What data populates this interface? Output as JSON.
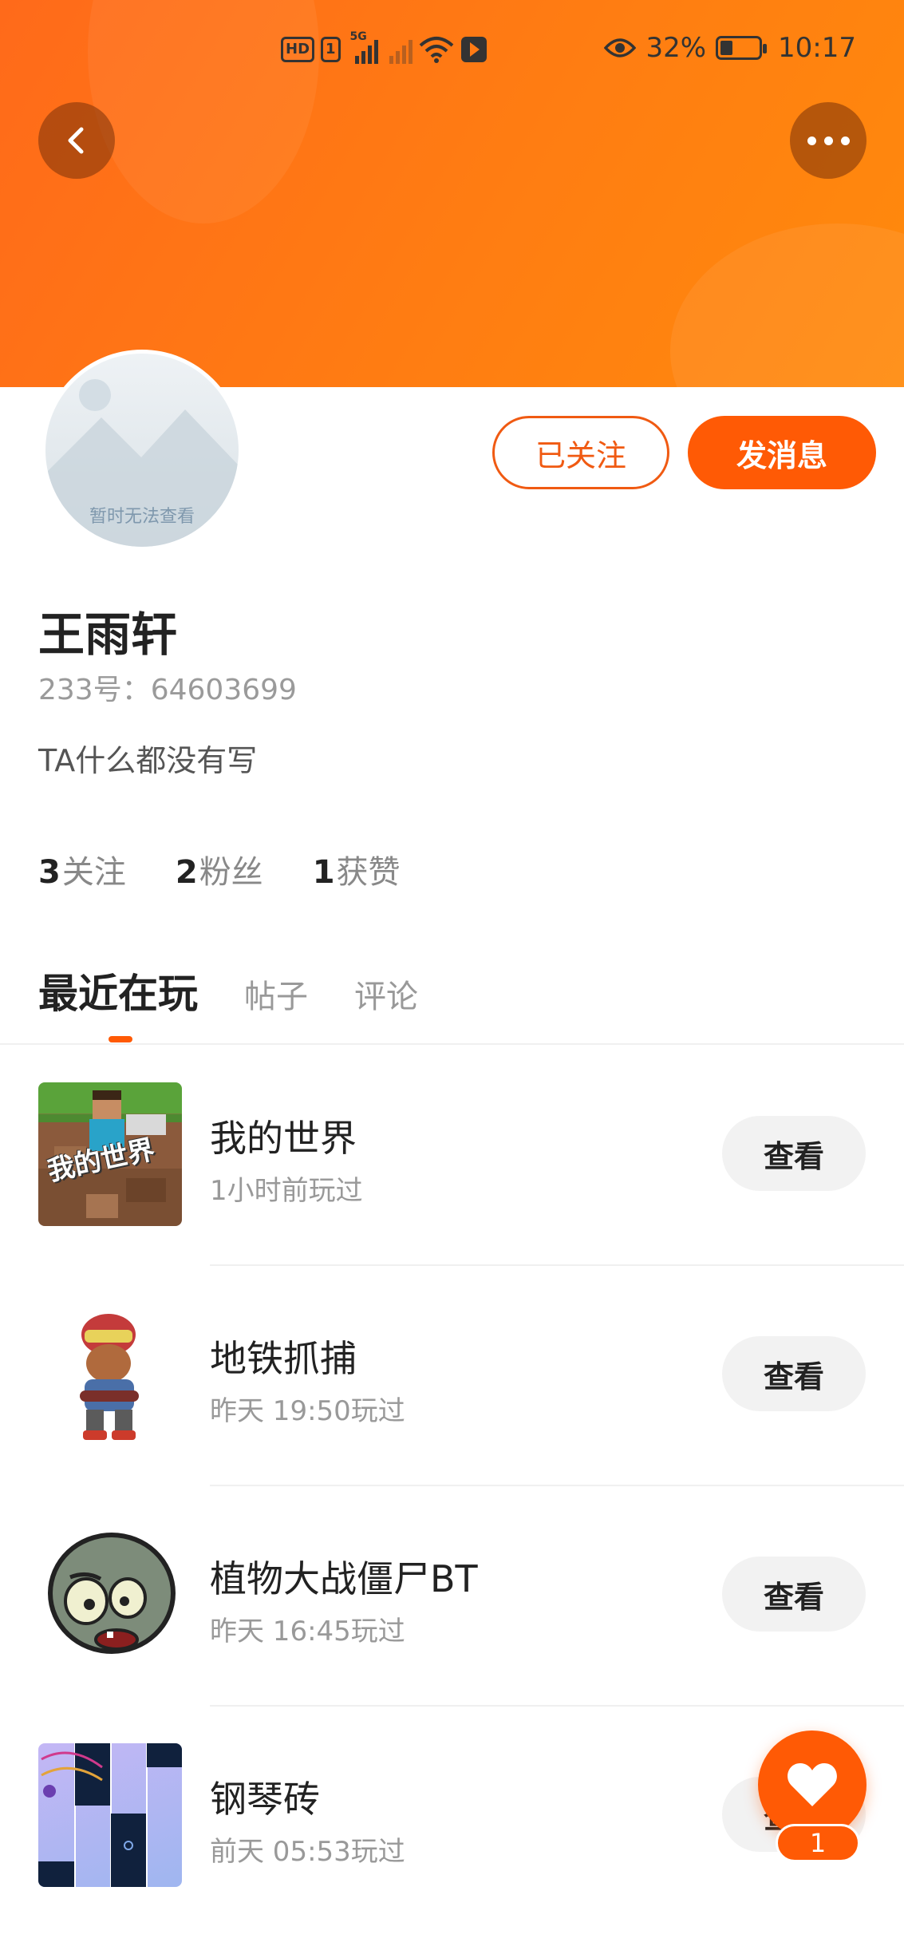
{
  "status_bar": {
    "hd_badge": "HD",
    "sim_badge": "1",
    "network_tag": "5G",
    "battery_pct": "32%",
    "battery_level": 0.32,
    "time": "10:17",
    "icons": [
      "signal-icon",
      "wifi-icon",
      "app-notification-icon",
      "eye-icon",
      "battery-icon"
    ]
  },
  "header": {
    "accent_color": "#ff6a1a",
    "back_icon": "chevron-left-icon",
    "more_icon": "more-dots-icon"
  },
  "profile": {
    "avatar_label": "暂时无法查看",
    "name": "王雨轩",
    "uid": "233号：64603699",
    "bio": "TA什么都没有写",
    "follow_label": "已关注",
    "message_label": "发消息",
    "stats": [
      {
        "count": "3",
        "label": "关注"
      },
      {
        "count": "2",
        "label": "粉丝"
      },
      {
        "count": "1",
        "label": "获赞"
      }
    ]
  },
  "tabs": [
    {
      "label": "最近在玩",
      "active": true
    },
    {
      "label": "帖子",
      "active": false
    },
    {
      "label": "评论",
      "active": false
    }
  ],
  "games": [
    {
      "title": "我的世界",
      "played": "1小时前玩过",
      "action": "查看",
      "icon": "minecraft-game-icon",
      "icon_text": "我的世界"
    },
    {
      "title": "地铁抓捕",
      "played": "昨天 19:50玩过",
      "action": "查看",
      "icon": "subway-surfers-game-icon"
    },
    {
      "title": "植物大战僵尸BT",
      "played": "昨天 16:45玩过",
      "action": "查看",
      "icon": "zombie-game-icon"
    },
    {
      "title": "钢琴砖",
      "played": "前天 05:53玩过",
      "action": "查看",
      "icon": "piano-tiles-game-icon"
    }
  ],
  "fab": {
    "icon": "heart-icon",
    "count": "1"
  }
}
